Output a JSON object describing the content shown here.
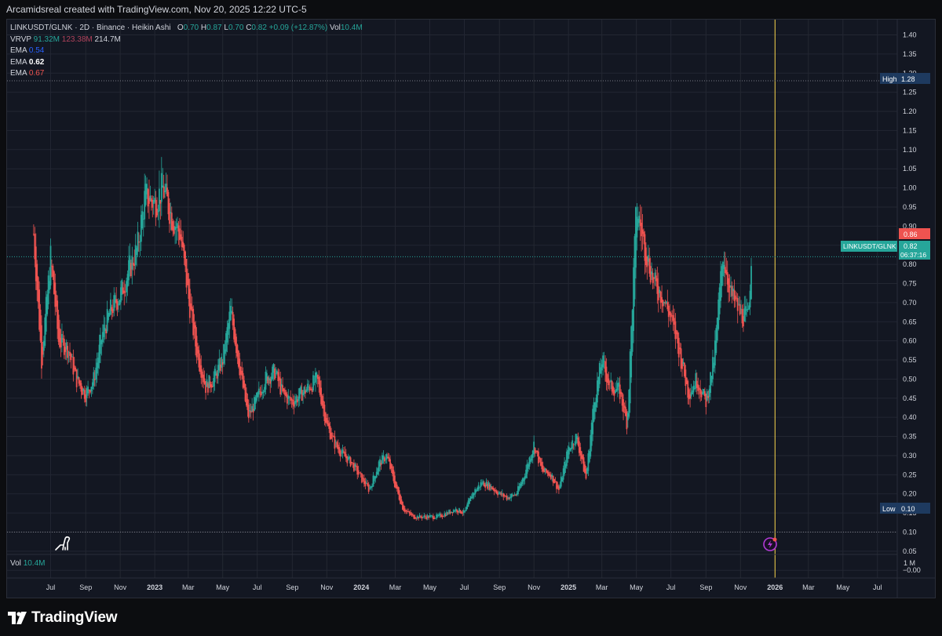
{
  "header": {
    "credit": "Arcamidsreal created with TradingView.com, Nov 20, 2025 12:22 UTC-5"
  },
  "legend": {
    "symbol_line": "LINKUSDT/GLNK · 2D · Binance · Heikin Ashi",
    "ohlc": [
      {
        "k": "O",
        "v": "0.70"
      },
      {
        "k": "H",
        "v": "0.87"
      },
      {
        "k": "L",
        "v": "0.70"
      },
      {
        "k": "C",
        "v": "0.82"
      }
    ],
    "change": "+0.09 (+12.87%)",
    "vol_label": "Vol",
    "vol_value": "10.4M",
    "vrvp": {
      "label": "VRVP",
      "up": "91.32M",
      "down": "123.38M",
      "total": "214.7M"
    },
    "emas": [
      {
        "label": "EMA",
        "value": "0.54",
        "color": "#2962ff"
      },
      {
        "label": "EMA",
        "value": "0.62",
        "color": "#ffffff"
      },
      {
        "label": "EMA",
        "value": "0.67",
        "color": "#ef5350"
      }
    ]
  },
  "volume_pane": {
    "label": "Vol",
    "value": "10.4M",
    "scale_label": "1 M"
  },
  "price_tags": {
    "high_label": "High",
    "high_value": "1.28",
    "low_label": "Low",
    "low_value": "0.10",
    "symbol": "LINKUSDT/GLNK",
    "last": "0.82",
    "countdown": "06:37:16",
    "prev": "0.86"
  },
  "colors": {
    "up": "#26a69a",
    "down": "#ef5350",
    "grid": "#2a2e39",
    "background": "#131722",
    "year_marker": "#f7d34a"
  },
  "footer": {
    "brand": "TradingView"
  },
  "chart_data": {
    "type": "line",
    "style": "candlestick-heikin-ashi",
    "y_axis_ticks": [
      "1.40",
      "1.35",
      "1.30",
      "1.25",
      "1.20",
      "1.15",
      "1.10",
      "1.05",
      "1.00",
      "0.95",
      "0.90",
      "0.85",
      "0.80",
      "0.75",
      "0.70",
      "0.65",
      "0.60",
      "0.55",
      "0.50",
      "0.45",
      "0.40",
      "0.35",
      "0.30",
      "0.25",
      "0.20",
      "0.15",
      "0.10",
      "0.05",
      "−0.00"
    ],
    "y_tick_values": [
      1.4,
      1.35,
      1.3,
      1.25,
      1.2,
      1.15,
      1.1,
      1.05,
      1.0,
      0.95,
      0.9,
      0.85,
      0.8,
      0.75,
      0.7,
      0.65,
      0.6,
      0.55,
      0.5,
      0.45,
      0.4,
      0.35,
      0.3,
      0.25,
      0.2,
      0.15,
      0.1,
      0.05,
      0.0
    ],
    "ylim": [
      -0.02,
      1.44
    ],
    "x_axis_ticks": [
      "Jul",
      "Sep",
      "Nov",
      "2023",
      "Mar",
      "May",
      "Jul",
      "Sep",
      "Nov",
      "2024",
      "Mar",
      "May",
      "Jul",
      "Sep",
      "Nov",
      "2025",
      "Mar",
      "May",
      "Jul",
      "Sep",
      "Nov",
      "2026",
      "Mar",
      "May",
      "Jul"
    ],
    "x_tick_dates": [
      "2022-07-01",
      "2022-09-01",
      "2022-11-01",
      "2023-01-01",
      "2023-03-01",
      "2023-05-01",
      "2023-07-01",
      "2023-09-01",
      "2023-11-01",
      "2024-01-01",
      "2024-03-01",
      "2024-05-01",
      "2024-07-01",
      "2024-09-01",
      "2024-11-01",
      "2025-01-01",
      "2025-03-01",
      "2025-05-01",
      "2025-07-01",
      "2025-09-01",
      "2025-11-01",
      "2026-01-01",
      "2026-03-01",
      "2026-05-01",
      "2026-07-01"
    ],
    "xlim": [
      "2022-04-15",
      "2026-08-05"
    ],
    "year_marker_date": "2026-01-01",
    "high_level": 1.28,
    "low_level": 0.1,
    "last_price": 0.82,
    "series": [
      {
        "x": [
          "2022-06-01",
          "2022-06-15",
          "2022-07-01",
          "2022-07-15",
          "2022-08-01",
          "2022-08-15",
          "2022-09-01",
          "2022-09-15",
          "2022-10-01",
          "2022-10-15",
          "2022-11-01",
          "2022-11-15",
          "2022-12-01",
          "2022-12-15",
          "2023-01-01",
          "2023-01-15",
          "2023-02-01",
          "2023-02-15",
          "2023-03-01",
          "2023-03-15",
          "2023-04-01",
          "2023-04-15",
          "2023-05-01",
          "2023-05-15",
          "2023-06-01",
          "2023-06-15",
          "2023-07-01",
          "2023-07-15",
          "2023-08-01",
          "2023-08-15",
          "2023-09-01",
          "2023-09-15",
          "2023-10-01",
          "2023-10-15",
          "2023-11-01",
          "2023-11-15",
          "2023-12-01",
          "2023-12-15",
          "2024-01-01",
          "2024-01-15",
          "2024-02-01",
          "2024-02-15",
          "2024-03-01",
          "2024-03-15",
          "2024-04-01",
          "2024-04-15",
          "2024-05-01",
          "2024-05-15",
          "2024-06-01",
          "2024-06-15",
          "2024-07-01",
          "2024-07-15",
          "2024-08-01",
          "2024-08-15",
          "2024-09-01",
          "2024-09-15",
          "2024-10-01",
          "2024-10-15",
          "2024-11-01",
          "2024-11-15",
          "2024-12-01",
          "2024-12-15",
          "2025-01-01",
          "2025-01-15",
          "2025-02-01",
          "2025-02-15",
          "2025-03-01",
          "2025-03-15",
          "2025-04-01",
          "2025-04-15",
          "2025-05-01",
          "2025-05-15",
          "2025-06-01",
          "2025-06-15",
          "2025-07-01",
          "2025-07-15",
          "2025-08-01",
          "2025-08-15",
          "2025-09-01",
          "2025-09-15",
          "2025-10-01",
          "2025-10-15",
          "2025-11-01",
          "2025-11-15",
          "2025-11-20"
        ],
        "values": [
          0.88,
          0.55,
          0.82,
          0.6,
          0.58,
          0.5,
          0.46,
          0.5,
          0.62,
          0.68,
          0.72,
          0.78,
          0.84,
          0.98,
          0.96,
          1.0,
          0.92,
          0.88,
          0.72,
          0.58,
          0.48,
          0.5,
          0.55,
          0.68,
          0.52,
          0.4,
          0.45,
          0.5,
          0.52,
          0.46,
          0.44,
          0.46,
          0.48,
          0.5,
          0.38,
          0.33,
          0.3,
          0.28,
          0.24,
          0.21,
          0.28,
          0.3,
          0.22,
          0.16,
          0.14,
          0.14,
          0.14,
          0.14,
          0.15,
          0.16,
          0.15,
          0.2,
          0.23,
          0.22,
          0.2,
          0.19,
          0.2,
          0.25,
          0.33,
          0.26,
          0.25,
          0.21,
          0.32,
          0.35,
          0.24,
          0.44,
          0.55,
          0.48,
          0.47,
          0.38,
          0.95,
          0.85,
          0.75,
          0.72,
          0.66,
          0.58,
          0.46,
          0.5,
          0.44,
          0.55,
          0.83,
          0.72,
          0.67,
          0.66,
          0.82
        ]
      }
    ]
  }
}
